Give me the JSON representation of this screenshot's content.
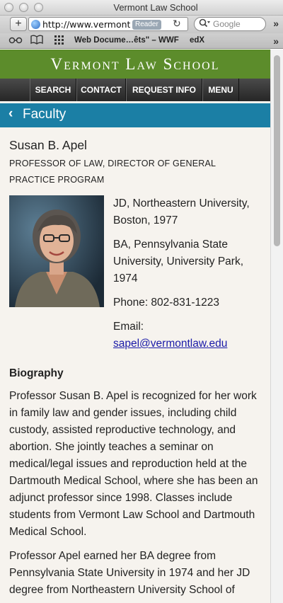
{
  "browser": {
    "window_title": "Vermont Law School",
    "url": "http://www.vermontlaw",
    "reader_label": "Reader",
    "search_placeholder": "Google",
    "bookmarks": [
      "Web Docume…êts\" – WWF",
      "edX"
    ]
  },
  "site": {
    "title": "Vermont Law School",
    "nav": [
      "SEARCH",
      "CONTACT",
      "REQUEST INFO",
      "MENU"
    ],
    "section": "Faculty",
    "colors": {
      "header_green": "#5c8c2b",
      "section_blue": "#1b7fa5",
      "nav_dark": "#2f2f2f"
    }
  },
  "profile": {
    "name": "Susan B. Apel",
    "title_line1": "PROFESSOR OF LAW, DIRECTOR OF GENERAL",
    "title_line2": "PRACTICE PROGRAM",
    "education": [
      "JD, Northeastern University, Boston, 1977",
      "BA, Pennsylvania State University, University Park, 1974"
    ],
    "phone": "Phone: 802-831-1223",
    "email_label": "Email:",
    "email": "sapel@vermontlaw.edu"
  },
  "biography": {
    "heading": "Biography",
    "paragraphs": [
      "Professor Susan B. Apel is recognized for her work in family law and gender issues, including child custody, assisted reproductive technology, and abortion. She jointly teaches a seminar on medical/legal issues and reproduction held at the Dartmouth Medical School, where she has been an adjunct professor since 1998. Classes include students from Vermont Law School and Dartmouth Medical School.",
      "Professor Apel earned her BA degree from Pennsylvania State University in 1974 and her JD degree from Northeastern University School of"
    ]
  },
  "icons": {
    "add": "+",
    "reload": "↻",
    "overflow": "»",
    "back": "‹"
  }
}
